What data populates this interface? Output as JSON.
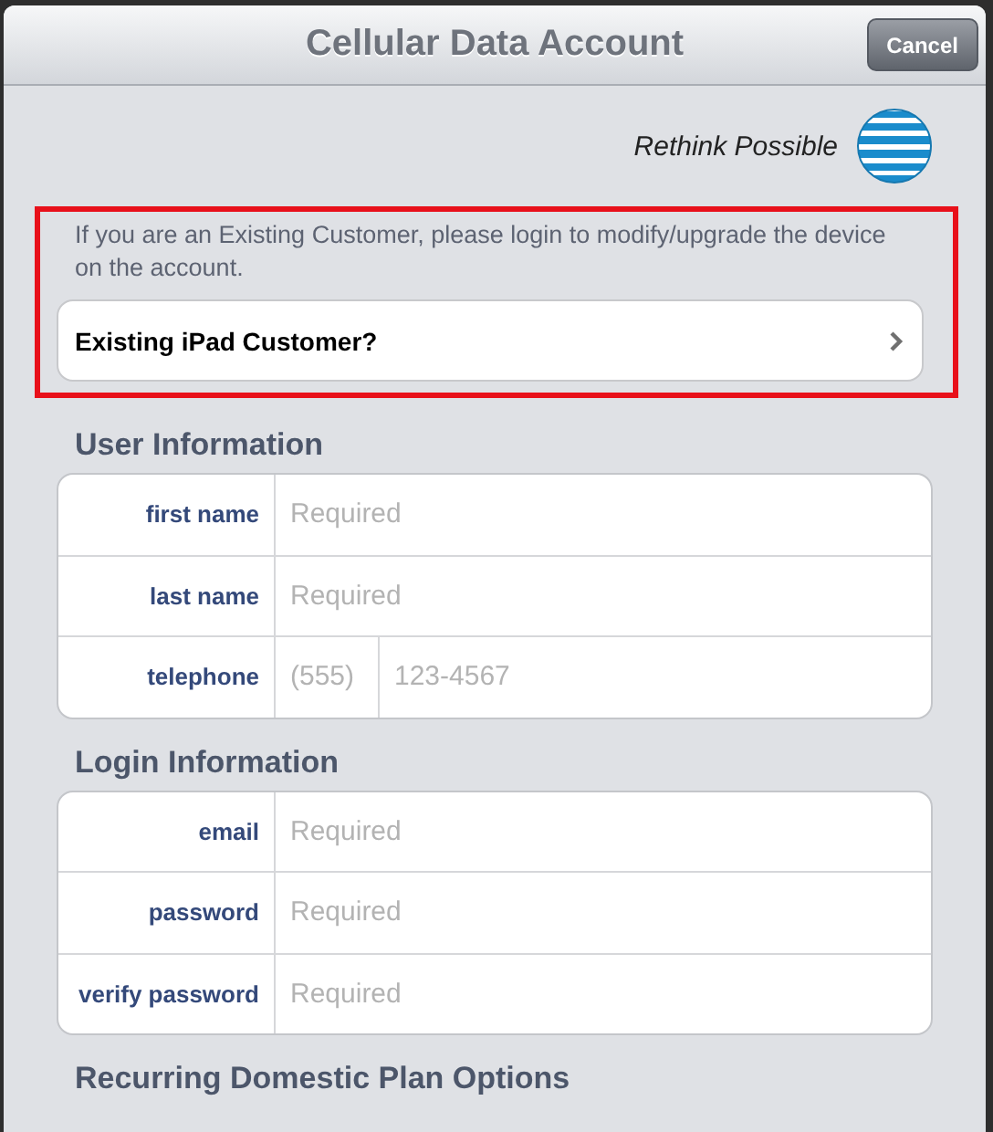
{
  "window": {
    "title": "Cellular Data Account"
  },
  "cancel_button": {
    "label": "Cancel"
  },
  "brand": {
    "tagline": "Rethink Possible"
  },
  "existing_customer": {
    "message": "If you are an Existing Customer, please login to modify/upgrade the device on the account.",
    "button": "Existing iPad Customer?"
  },
  "sections": [
    {
      "title": "User Information",
      "fields": [
        {
          "kind": "text",
          "label": "first name",
          "placeholder": "Required"
        },
        {
          "kind": "text",
          "label": "last name",
          "placeholder": "Required"
        },
        {
          "kind": "phone",
          "label": "telephone",
          "placeholders": [
            "(555)",
            "123-4567"
          ]
        }
      ]
    },
    {
      "title": "Login Information",
      "fields": [
        {
          "kind": "text",
          "label": "email",
          "placeholder": "Required"
        },
        {
          "kind": "text",
          "label": "password",
          "placeholder": "Required"
        },
        {
          "kind": "text",
          "label": "verify password",
          "placeholder": "Required"
        }
      ]
    },
    {
      "title": "Recurring Domestic Plan Options"
    }
  ]
}
